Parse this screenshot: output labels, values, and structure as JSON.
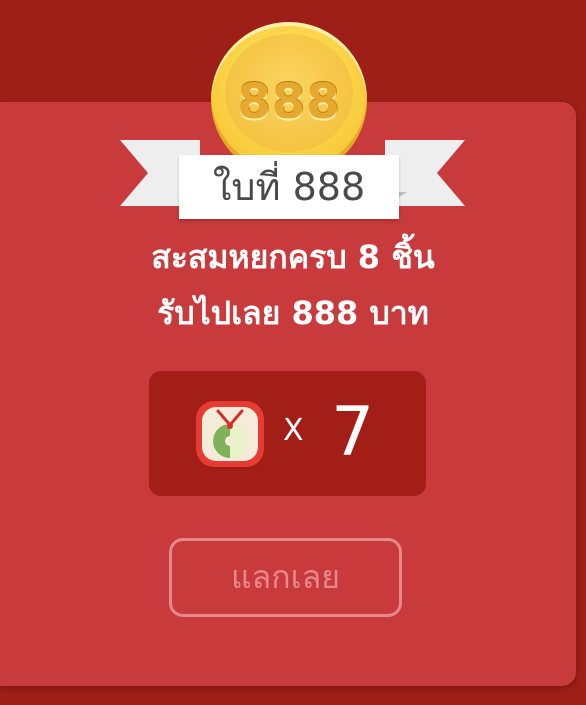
{
  "coin": {
    "value": "888"
  },
  "ribbon": {
    "label": "ใบที่ 888"
  },
  "headline": {
    "line1": "สะสมหยกครบ 8 ชิ้น",
    "line2": "รับไปเลย 888 บาท"
  },
  "counter": {
    "icon": "jade-pendant-icon",
    "times": "X",
    "count": "7"
  },
  "redeem": {
    "label": "แลกเลย"
  },
  "colors": {
    "background": "#9d1f17",
    "card": "#c93a3c",
    "counter_bg": "#a21e16",
    "gold": "#fbd64b",
    "button_outline": "#e7898b"
  }
}
